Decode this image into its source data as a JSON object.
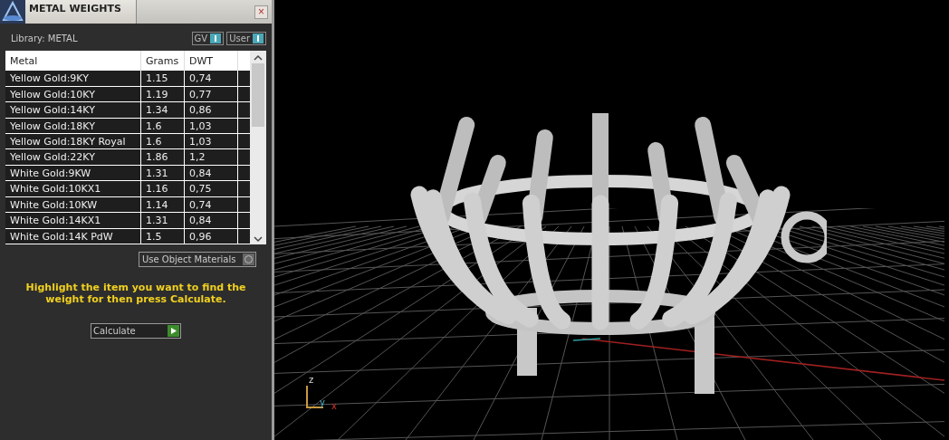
{
  "panel": {
    "title": "METAL WEIGHTS",
    "close": "×",
    "library_label": "Library: METAL",
    "toggles": [
      {
        "label": "GV",
        "on": true
      },
      {
        "label": "User",
        "on": true
      }
    ],
    "table": {
      "columns": [
        "Metal",
        "Grams",
        "DWT"
      ],
      "rows": [
        {
          "metal": "Yellow Gold:9KY",
          "grams": "1.15",
          "dwt": "0,74"
        },
        {
          "metal": "Yellow Gold:10KY",
          "grams": "1.19",
          "dwt": "0,77"
        },
        {
          "metal": "Yellow Gold:14KY",
          "grams": "1.34",
          "dwt": "0,86"
        },
        {
          "metal": "Yellow Gold:18KY",
          "grams": "1.6",
          "dwt": "1,03"
        },
        {
          "metal": "Yellow Gold:18KY Royal",
          "grams": "1.6",
          "dwt": "1,03"
        },
        {
          "metal": "Yellow Gold:22KY",
          "grams": "1.86",
          "dwt": "1,2"
        },
        {
          "metal": "White Gold:9KW",
          "grams": "1.31",
          "dwt": "0,84"
        },
        {
          "metal": "White Gold:10KX1",
          "grams": "1.16",
          "dwt": "0,75"
        },
        {
          "metal": "White Gold:10KW",
          "grams": "1.14",
          "dwt": "0,74"
        },
        {
          "metal": "White Gold:14KX1",
          "grams": "1.31",
          "dwt": "0,84"
        },
        {
          "metal": "White Gold:14K PdW",
          "grams": "1.5",
          "dwt": "0,96"
        }
      ]
    },
    "use_object_materials": {
      "label": "Use Object Materials",
      "checked": false
    },
    "instruction": "Highlight the item you want to find the weight for then press Calculate.",
    "calculate_button": "Calculate"
  },
  "viewport": {
    "axes": [
      "z",
      "y",
      "x"
    ]
  }
}
